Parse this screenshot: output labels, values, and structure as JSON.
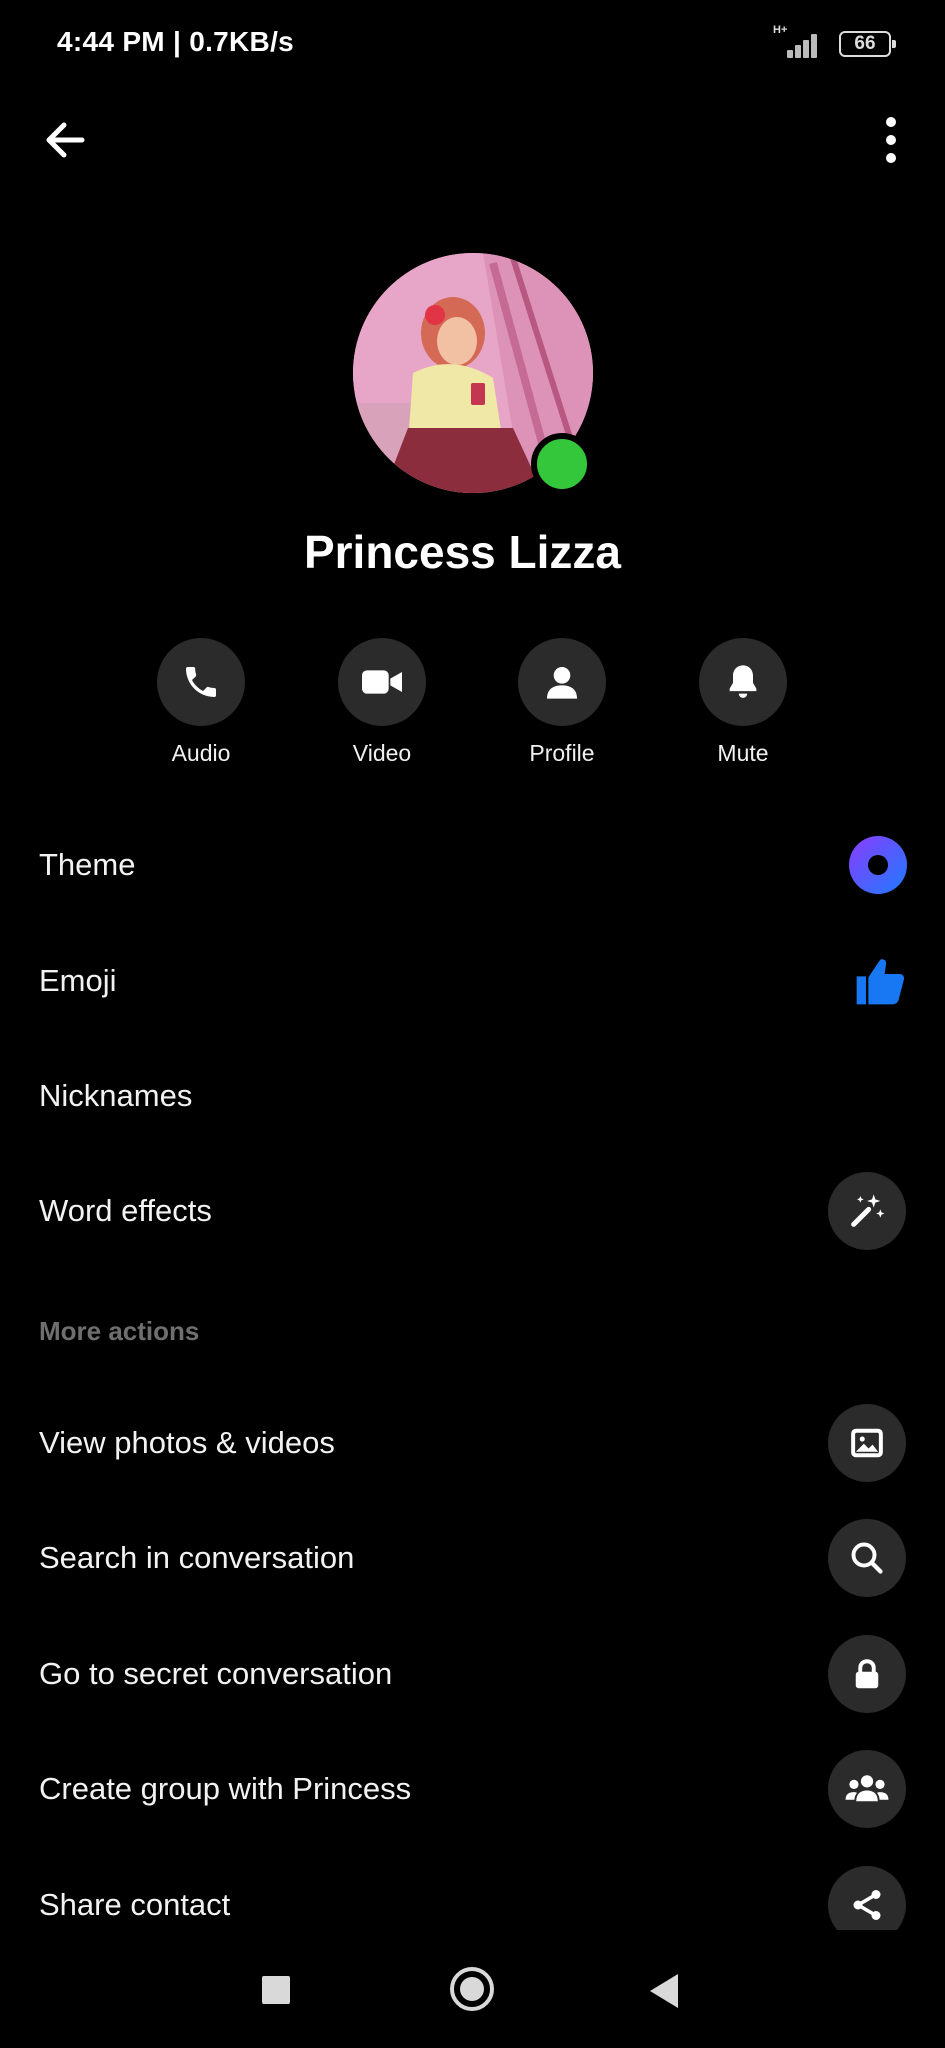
{
  "status_bar": {
    "time": "4:44 PM | 0.7KB/s",
    "network": "H+",
    "battery": "66"
  },
  "profile": {
    "name": "Princess Lizza"
  },
  "actions": [
    {
      "label": "Audio",
      "icon": "phone-icon"
    },
    {
      "label": "Video",
      "icon": "video-camera-icon"
    },
    {
      "label": "Profile",
      "icon": "person-icon"
    },
    {
      "label": "Mute",
      "icon": "bell-icon"
    }
  ],
  "menu": {
    "theme": "Theme",
    "emoji": "Emoji",
    "nicknames": "Nicknames",
    "word_effects": "Word effects",
    "more_actions_header": "More actions",
    "view_photos": "View photos & videos",
    "search": "Search in conversation",
    "secret": "Go to secret conversation",
    "create_group": "Create group with Princess",
    "share_contact": "Share contact"
  },
  "colors": {
    "background": "#000000",
    "online": "#34c73b",
    "emoji_blue": "#1877f2",
    "theme_gradient_start": "#8a3cff",
    "theme_gradient_end": "#1e7bff",
    "icon_circle": "#2b2b2b",
    "section_header": "#6f6f6f"
  }
}
